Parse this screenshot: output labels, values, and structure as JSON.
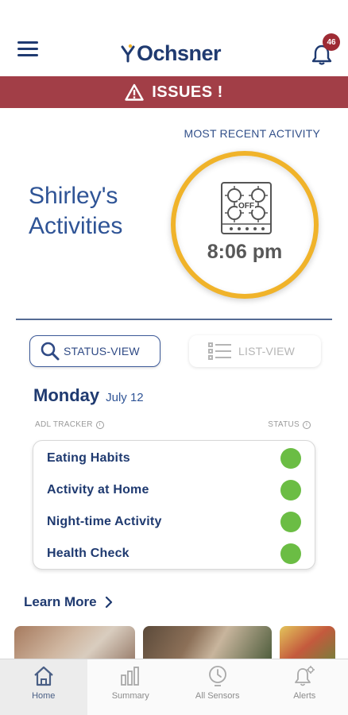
{
  "header": {
    "logo_text": "Ochsner",
    "alerts_count": "46"
  },
  "issues_banner": {
    "label": "ISSUES !"
  },
  "activity": {
    "most_recent_label": "MOST RECENT ACTIVITY",
    "title_line1": "Shirley's",
    "title_line2": "Activities",
    "stove_status": "OFF",
    "time": "8:06 pm"
  },
  "views": {
    "status_view_label": "STATUS-VIEW",
    "list_view_label": "LIST-VIEW"
  },
  "day": {
    "name": "Monday",
    "date": "July 12"
  },
  "tracker": {
    "adl_header": "ADL TRACKER",
    "status_header": "STATUS",
    "status_color": "#6bbd44",
    "items": [
      {
        "label": "Eating Habits"
      },
      {
        "label": "Activity at Home"
      },
      {
        "label": "Night-time Activity"
      },
      {
        "label": "Health Check"
      }
    ]
  },
  "learn_more": {
    "label": "Learn More"
  },
  "bottom_nav": {
    "items": [
      {
        "label": "Home",
        "icon": "home-icon"
      },
      {
        "label": "Summary",
        "icon": "bar-chart-icon"
      },
      {
        "label": "All Sensors",
        "icon": "clock-icon"
      },
      {
        "label": "Alerts",
        "icon": "bell-gear-icon"
      }
    ]
  },
  "colors": {
    "brand_navy": "#1f3a70",
    "issues_red": "#a23e47",
    "badge_red": "#9e2b34",
    "ring_gold": "#f0b32a"
  }
}
